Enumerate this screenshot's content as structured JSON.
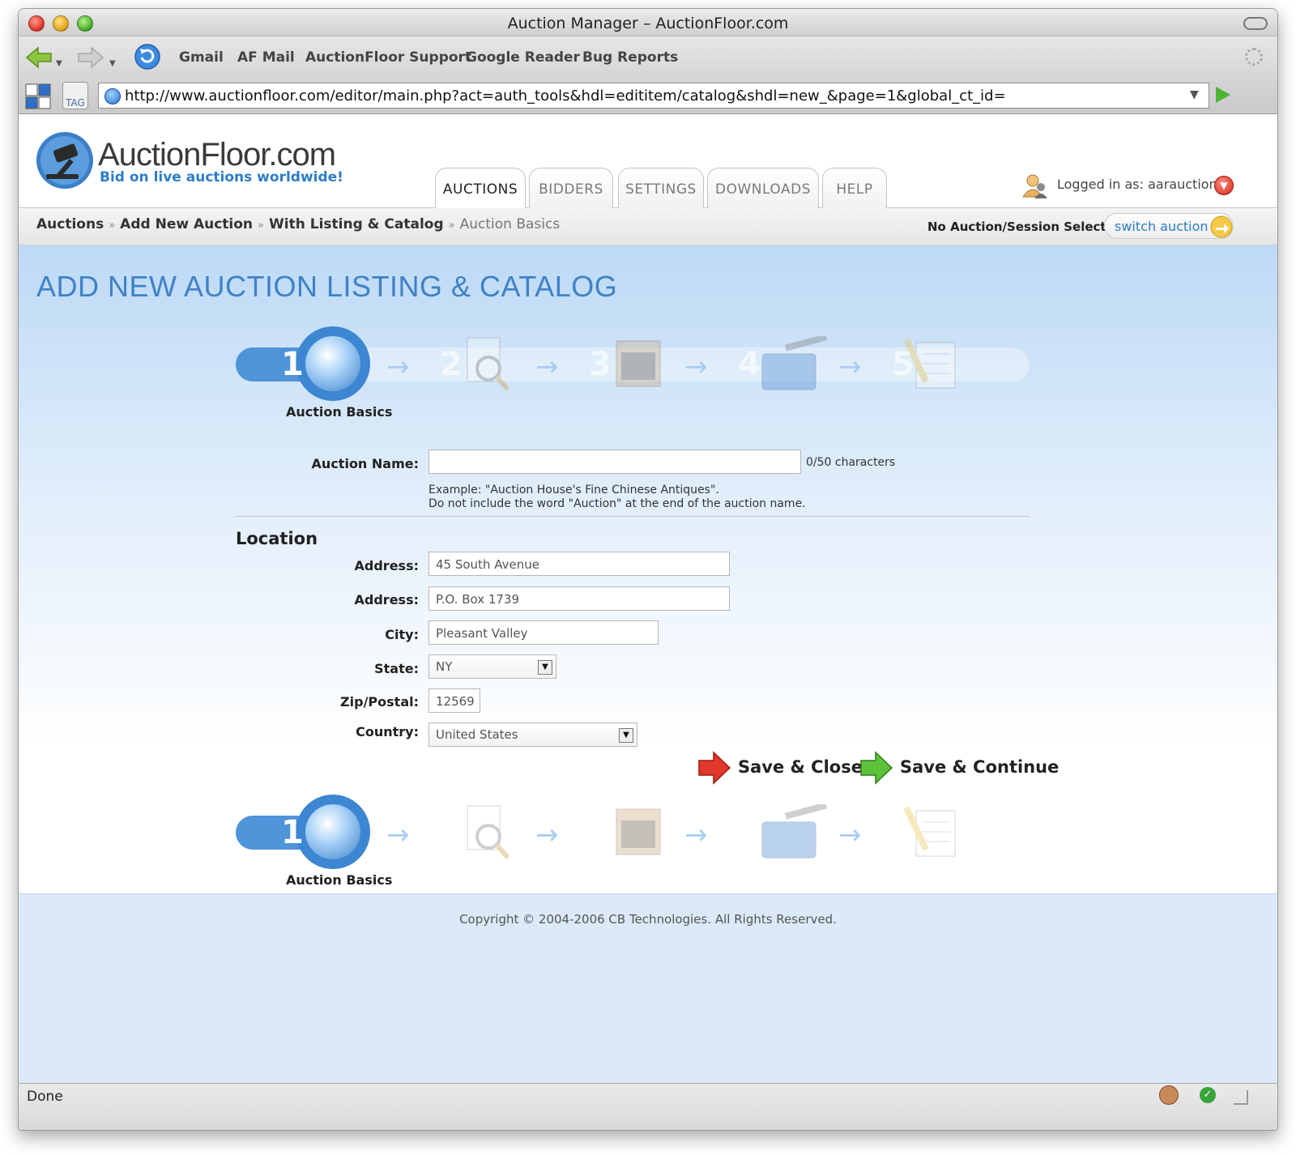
{
  "window": {
    "title": "Auction Manager – AuctionFloor.com"
  },
  "bookmarks": [
    "Gmail",
    "AF Mail",
    "AuctionFloor Support",
    "Google Reader",
    "Bug Reports"
  ],
  "toolbar": {
    "tag_label": "TAG"
  },
  "address": {
    "url": "http://www.auctionfloor.com/editor/main.php?act=auth_tools&hdl=edititem/catalog&shdl=new_&page=1&global_ct_id="
  },
  "site": {
    "logo_text": "AuctionFloor.com",
    "tagline": "Bid on live auctions worldwide!",
    "tabs": [
      "AUCTIONS",
      "BIDDERS",
      "SETTINGS",
      "DOWNLOADS",
      "HELP"
    ],
    "active_tab": "AUCTIONS",
    "logged_in": "Logged in as: aarauctions"
  },
  "breadcrumb": {
    "items": [
      "Auctions",
      "Add New Auction",
      "With Listing & Catalog"
    ],
    "current": "Auction Basics",
    "separator": "»"
  },
  "session": {
    "status": "No Auction/Session Selected",
    "switch_label": "switch auction"
  },
  "page": {
    "title": "ADD NEW AUCTION LISTING & CATALOG"
  },
  "steps": {
    "numbers": [
      "1",
      "2",
      "3",
      "4",
      "5"
    ],
    "current_label": "Auction Basics"
  },
  "form": {
    "auction_name": {
      "label": "Auction Name:",
      "value": "",
      "char_count": "0/50 characters",
      "hint1": "Example: \"Auction House's Fine Chinese Antiques\".",
      "hint2": "Do not include the word \"Auction\" at the end of the auction name."
    },
    "location_title": "Location",
    "address1": {
      "label": "Address:",
      "value": "45 South Avenue"
    },
    "address2": {
      "label": "Address:",
      "value": "P.O. Box 1739"
    },
    "city": {
      "label": "City:",
      "value": "Pleasant Valley"
    },
    "state": {
      "label": "State:",
      "value": "NY"
    },
    "zip": {
      "label": "Zip/Postal:",
      "value": "12569"
    },
    "country": {
      "label": "Country:",
      "value": "United States"
    }
  },
  "actions": {
    "save_close": "Save & Close",
    "save_continue": "Save & Continue"
  },
  "footer": {
    "copyright": "Copyright © 2004-2006 CB Technologies. All Rights Reserved."
  },
  "status": {
    "text": "Done"
  },
  "colors": {
    "brand_blue": "#3f82c6",
    "step_blue": "#4f93d8",
    "save_close_red": "#e0392b",
    "save_continue_green": "#5cc23a"
  },
  "icons": [
    "back-arrow-icon",
    "forward-arrow-icon",
    "reload-icon",
    "globe-icon",
    "gavel-logo-icon",
    "user-icon",
    "logout-icon",
    "switch-arrow-icon"
  ]
}
